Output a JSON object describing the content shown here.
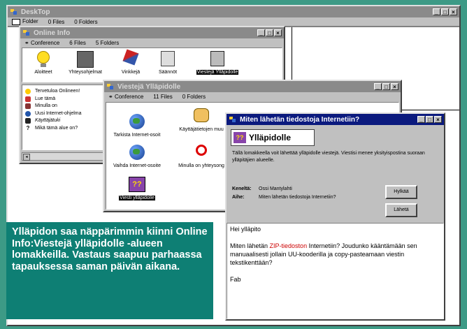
{
  "desktop": {
    "title": "DeskTop",
    "toolbar": {
      "folder": "Folder",
      "files": "0 Files",
      "folders": "0 Folders"
    }
  },
  "online_info": {
    "title": "Online Info",
    "toolbar": {
      "conference": "Conference",
      "files": "6 Files",
      "folders": "5 Folders"
    },
    "icons": [
      "Aloitteet",
      "Yhteysohjelmat",
      "Vinkkejä",
      "Säännöt",
      "Viestejä Ylläpidolle"
    ],
    "list": [
      "Tervetuloa Onlineen!",
      "Lue tämä",
      "Minulla on",
      "Uusi Internet-ohjelma",
      "Käyttäjätuki",
      "Mikä tämä alue on?"
    ]
  },
  "viesteja": {
    "title": "Viestejä Ylläpidolle",
    "toolbar": {
      "conference": "Conference",
      "files": "11 Files",
      "folders": "0 Folders"
    },
    "icons": [
      "Tarkista Internet-osoit",
      "Käyttäjätietojen muu",
      "Vaihda Internet-osoite",
      "Minulla on yhteysong",
      "Viesti ylläpidolle"
    ]
  },
  "message_window": {
    "title": "Miten lähetän tiedostoja Internetiin?",
    "header": "Ylläpidolle",
    "description": "Tällä lomakkeella voit lähettää ylläpidolle viestejä.  Viestisi menee yksityispostina suoraan ylläpitäjien alueelle.",
    "from_label": "Keneltä:",
    "from_value": "Ossi Mantylahti",
    "subject_label": "Aihe:",
    "subject_value": "Miten lähetän tiedostoja Internetiin?",
    "reject_button": "Hylkää",
    "send_button": "Lähetä",
    "body_greeting": "Hei ylläpito",
    "body_pre": "Miten lähetän ",
    "body_highlight": "ZIP-tiedoston",
    "body_post": " Internetiin? Joudunko kääntämään sen manuaalisesti jollain UU-kooderilla ja copy-pasteamaan viestin tekstikenttään?",
    "signature": "Fab"
  },
  "caption": "Ylläpidon saa näppärimmin kiinni Online Info:Viestejä ylläpidolle -alueen lomakkeilla. Vastaus saapuu parhaassa tapauksessa saman päivän aikana.",
  "colors": {
    "caption_bg": "#0e7f74",
    "active_title": "#0b1a7e",
    "inactive_title": "#8a8a8a",
    "highlight": "#cc0000"
  }
}
